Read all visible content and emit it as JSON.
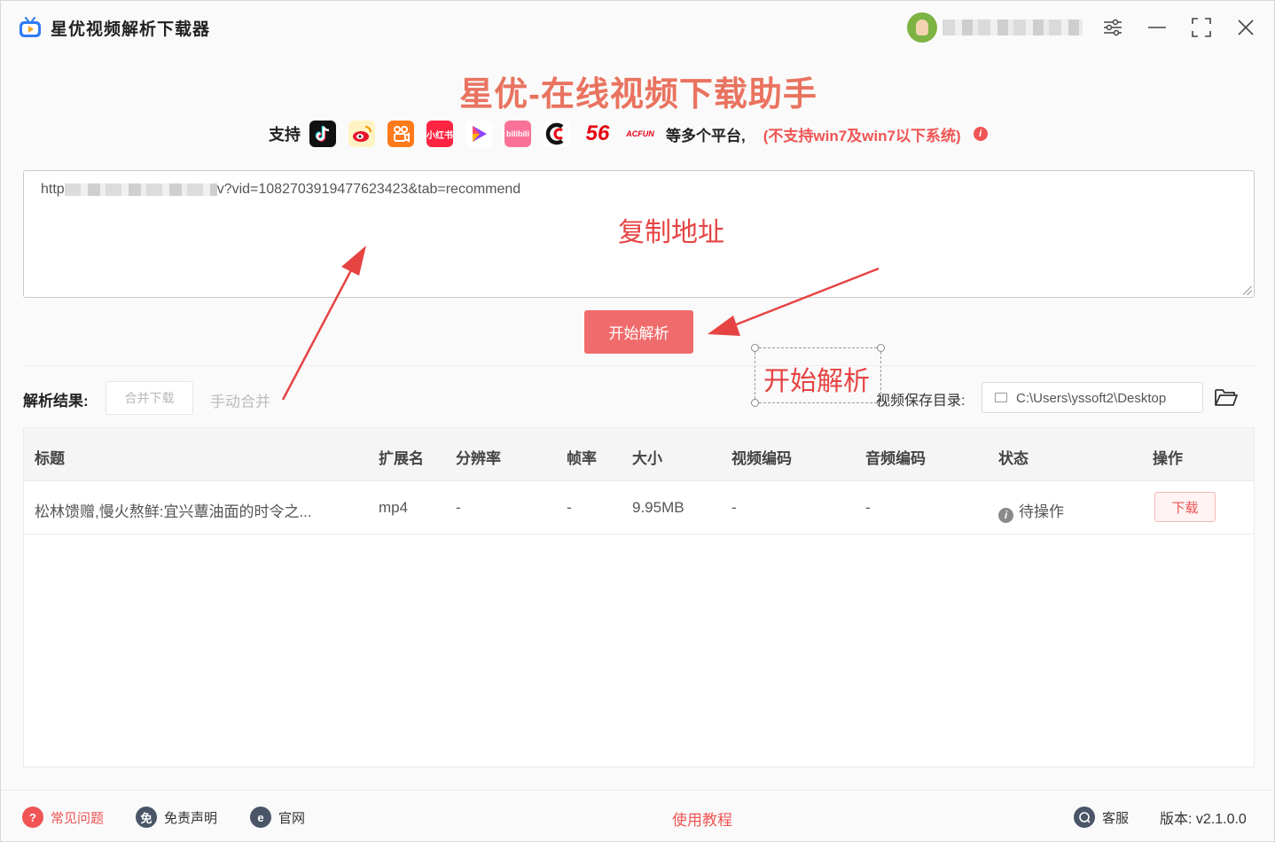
{
  "app": {
    "title": "星优视频解析下载器",
    "window_controls": [
      "settings",
      "minimize",
      "maximize",
      "close"
    ]
  },
  "header": {
    "title": "星优-在线视频下载助手",
    "support_label": "支持",
    "platforms": [
      {
        "name": "douyin",
        "label": "",
        "color": "#111111"
      },
      {
        "name": "weibo",
        "label": "",
        "color": "#f5c400"
      },
      {
        "name": "kuaishou",
        "label": "",
        "color": "#ff7a1a"
      },
      {
        "name": "xiaohongshu",
        "label": "小红书",
        "color": "#ff2442"
      },
      {
        "name": "video-play",
        "label": "",
        "color": "#ffffff"
      },
      {
        "name": "bilibili",
        "label": "bilibili",
        "color": "#fb7299"
      },
      {
        "name": "cctv",
        "label": "",
        "color": "#ffffff"
      },
      {
        "name": "56",
        "label": "56",
        "color": "#ffffff"
      },
      {
        "name": "acfun",
        "label": "ACFUN",
        "color": "#ffffff"
      }
    ],
    "more_platforms": "等多个平台,",
    "warning": "(不支持win7及win7以下系统)",
    "accent_color": "#e9735f"
  },
  "url_input": {
    "value_start": "http",
    "value_end": "v?vid=1082703919477623423&tab=recommend"
  },
  "annotations": {
    "copy_address": "复制地址",
    "start_parse": "开始解析",
    "color": "#e64343"
  },
  "actions": {
    "start_parse": "开始解析"
  },
  "results": {
    "label": "解析结果:",
    "merge_download": "合并下载",
    "manual_merge": "手动合并",
    "save_dir_label": "视频保存目录:",
    "save_dir_value": "C:\\Users\\yssoft2\\Desktop"
  },
  "table": {
    "headers": [
      "标题",
      "扩展名",
      "分辨率",
      "帧率",
      "大小",
      "视频编码",
      "音频编码",
      "状态",
      "操作"
    ],
    "rows": [
      {
        "title": "松林馈赠,慢火熬鲜:宜兴蕈油面的时令之...",
        "ext": "mp4",
        "resolution": "-",
        "fps": "-",
        "size": "9.95MB",
        "video_codec": "-",
        "audio_codec": "-",
        "status": "待操作",
        "action": "下载"
      }
    ]
  },
  "footer": {
    "faq": "常见问题",
    "disclaimer": "免责声明",
    "website": "官网",
    "tutorial": "使用教程",
    "support": "客服",
    "version": "版本: v2.1.0.0",
    "faq_icon": "?",
    "disclaimer_icon": "免",
    "website_icon": "e"
  }
}
